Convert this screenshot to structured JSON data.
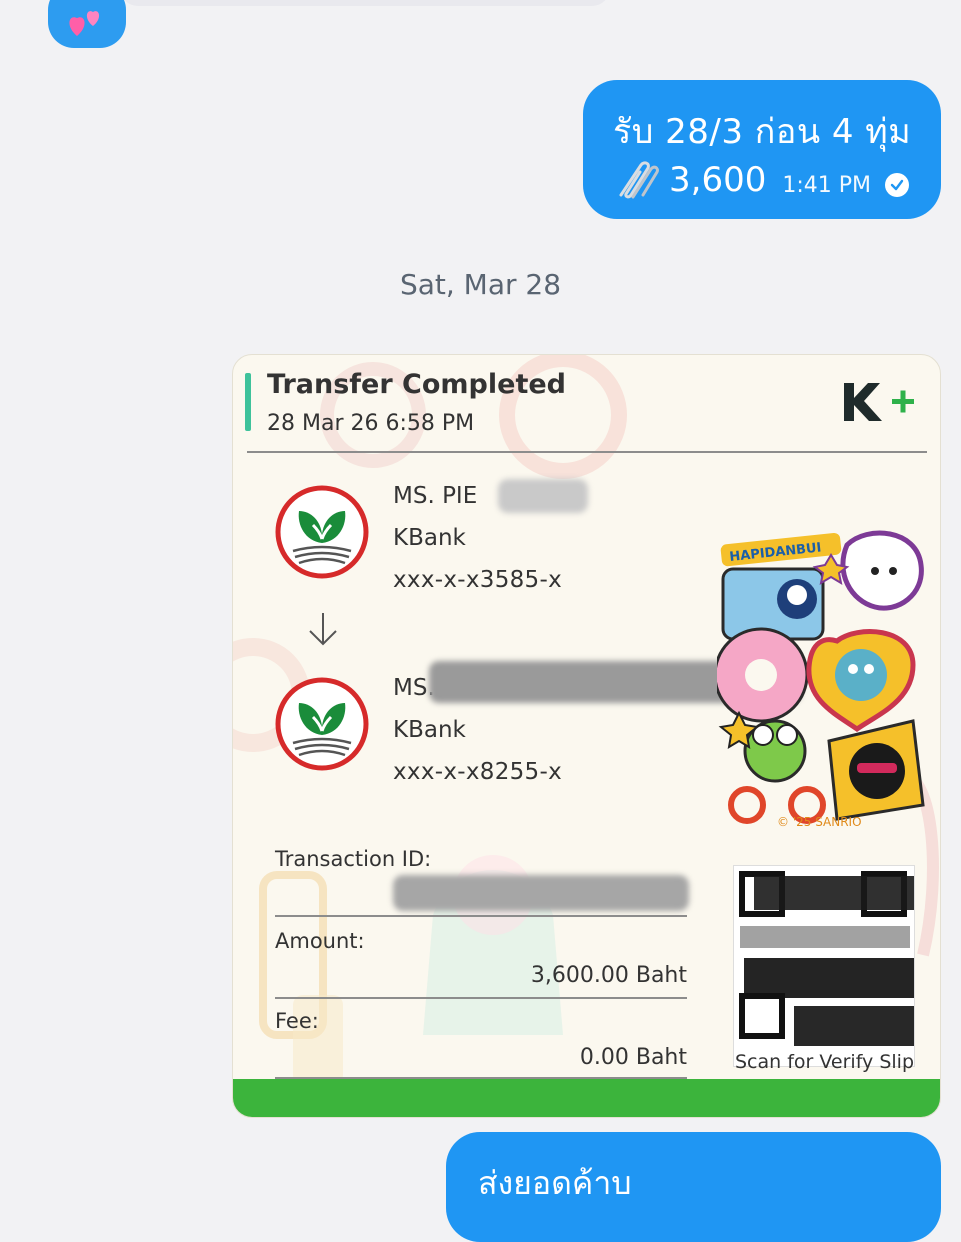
{
  "chat": {
    "emoji_icon": "two-hearts-icon",
    "outgoing_message": {
      "line1": "รับ 28/3 ก่อน 4 ทุ่ม",
      "amount": "3,600",
      "time": "1:41 PM",
      "status_icon": "read-check-icon"
    },
    "date_separator": "Sat, Mar 28",
    "bottom_message": "ส่งยอดค้าบ"
  },
  "slip": {
    "title": "Transfer Completed",
    "datetime": "28 Mar 26  6:58 PM",
    "brand": "K+",
    "sender": {
      "name": "MS. PIE",
      "bank": "KBank",
      "account": "xxx-x-x3585-x"
    },
    "receiver": {
      "name": "MS.",
      "bank": "KBank",
      "account": "xxx-x-x8255-x"
    },
    "transaction_id_label": "Transaction ID:",
    "amount_label": "Amount:",
    "amount_value": "3,600.00 Baht",
    "fee_label": "Fee:",
    "fee_value": "0.00 Baht",
    "qr_caption": "Scan for Verify Slip",
    "sticker_banner": "HAPIDANBUI",
    "copyright": "© '25 SANRIO",
    "colors": {
      "accent": "#3ec29b",
      "kbank_green": "#1a8c3a",
      "footer_green": "#3cb43c",
      "bubble_blue": "#1f96f3"
    }
  }
}
